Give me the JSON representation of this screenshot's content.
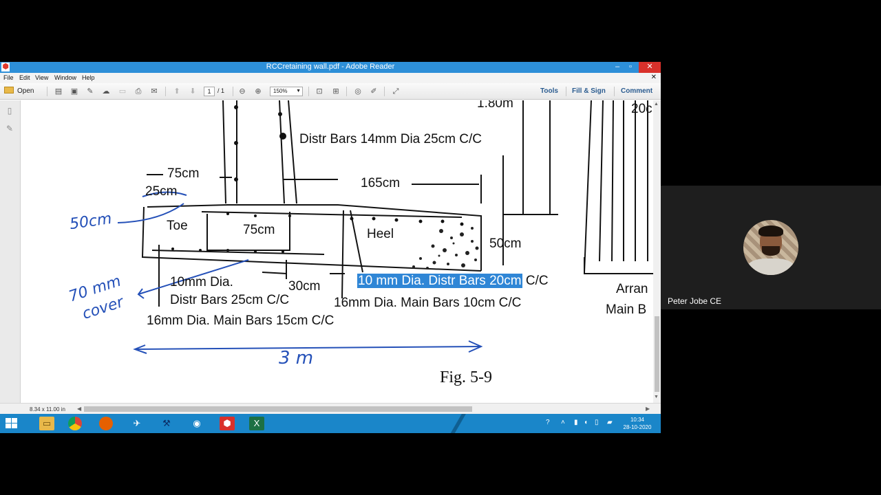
{
  "window": {
    "title": "RCCretaining wall.pdf - Adobe Reader",
    "buttons": {
      "minimize": "–",
      "restore": "▫",
      "close": "✕"
    }
  },
  "menu": [
    "File",
    "Edit",
    "View",
    "Window",
    "Help"
  ],
  "toolbar": {
    "open_label": "Open",
    "page_current": "1",
    "page_total": "/ 1",
    "zoom": "150%",
    "tools": "Tools",
    "fill_sign": "Fill & Sign",
    "comment": "Comment"
  },
  "document": {
    "labels": {
      "height_top": "1.80m",
      "twenty": "20c",
      "distr_top": "Distr Bars 14mm Dia 25cm C/C",
      "d75_top": "75cm",
      "d25": "25cm",
      "d165": "165cm",
      "toe": "Toe",
      "d75_mid": "75cm",
      "heel": "Heel",
      "d50": "50cm",
      "toe_bars_1": "10mm Dia.",
      "toe_bars_2": "Distr Bars 25cm C/C",
      "d30": "30cm",
      "heel_distr_highlight": "10 mm Dia. Distr Bars 20cm",
      "heel_distr_rest": "C/C",
      "heel_main": "16mm Dia. Main Bars 10cm C/C",
      "toe_main": "16mm Dia. Main Bars 15cm C/C",
      "arran": "Arran",
      "main_b": "Main B",
      "figure": "Fig.  5-9"
    },
    "annotations": {
      "fifty": "50cm",
      "cover_1": "70 mm",
      "cover_2": "cover",
      "span": "3 m"
    }
  },
  "status": {
    "page_size": "8.34 x 11.00 in"
  },
  "taskbar": {
    "time": "10:34",
    "date": "28-10-2020",
    "icons": [
      "start",
      "file-explorer",
      "chrome",
      "firefox",
      "app",
      "tool",
      "camera",
      "acrobat",
      "excel"
    ]
  },
  "participant": {
    "name": "Peter Jobe CE"
  },
  "colors": {
    "titlebar": "#2d8fd8",
    "taskbar": "#1a86c9",
    "highlight": "#2f86d6",
    "ink": "#2450b8"
  }
}
